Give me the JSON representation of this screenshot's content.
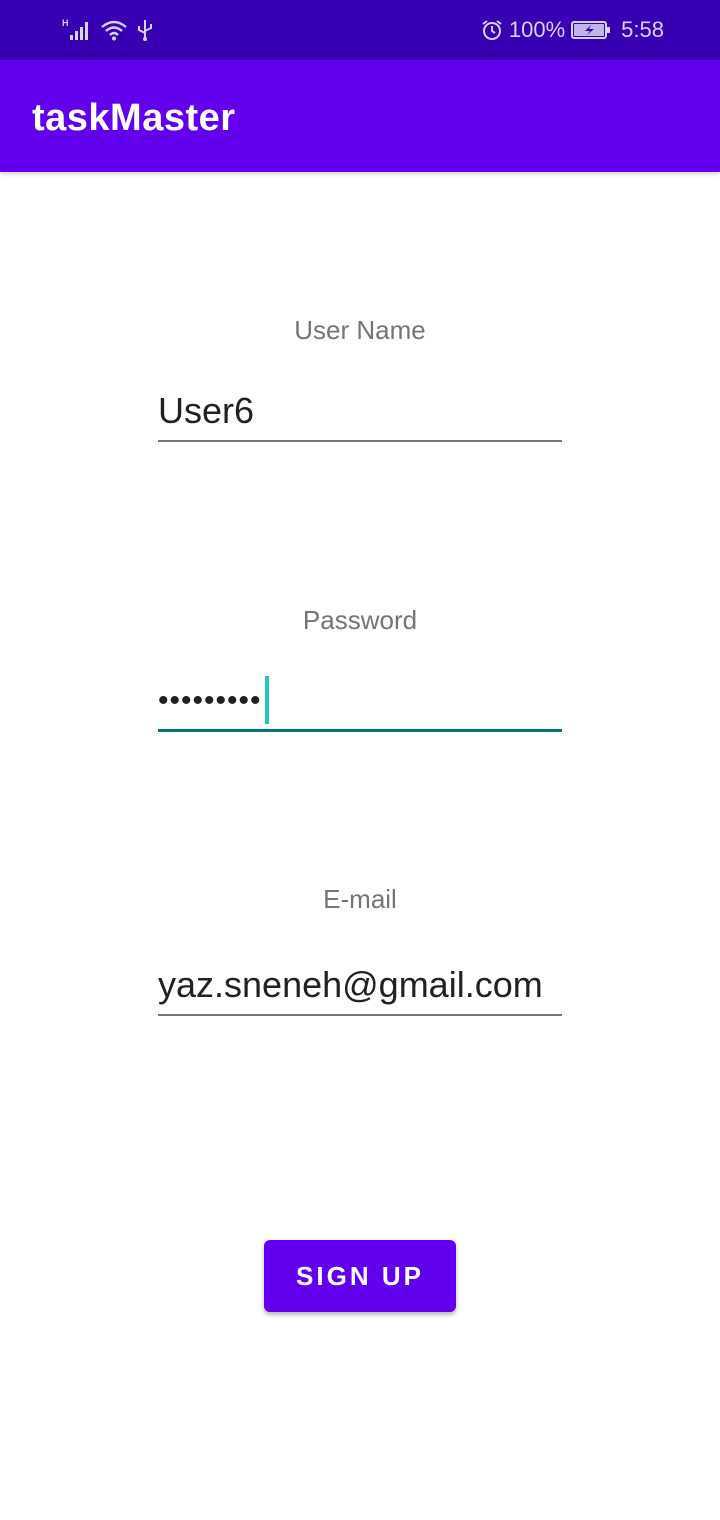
{
  "status_bar": {
    "network_type": "H",
    "battery_percent": "100%",
    "time": "5:58",
    "icons": [
      "signal-icon",
      "wifi-icon",
      "usb-icon",
      "alarm-icon",
      "battery-charging-icon"
    ]
  },
  "app_bar": {
    "title": "taskMaster"
  },
  "form": {
    "username": {
      "label": "User Name",
      "value": "User6"
    },
    "password": {
      "label": "Password",
      "value": "•••••••••"
    },
    "email": {
      "label": "E-mail",
      "value": "yaz.sneneh@gmail.com"
    }
  },
  "actions": {
    "signup_label": "SIGN UP"
  },
  "colors": {
    "status_bar": "#3700b3",
    "primary": "#6200ee",
    "focus_underline": "#00796b",
    "cursor": "#26c6b5"
  }
}
